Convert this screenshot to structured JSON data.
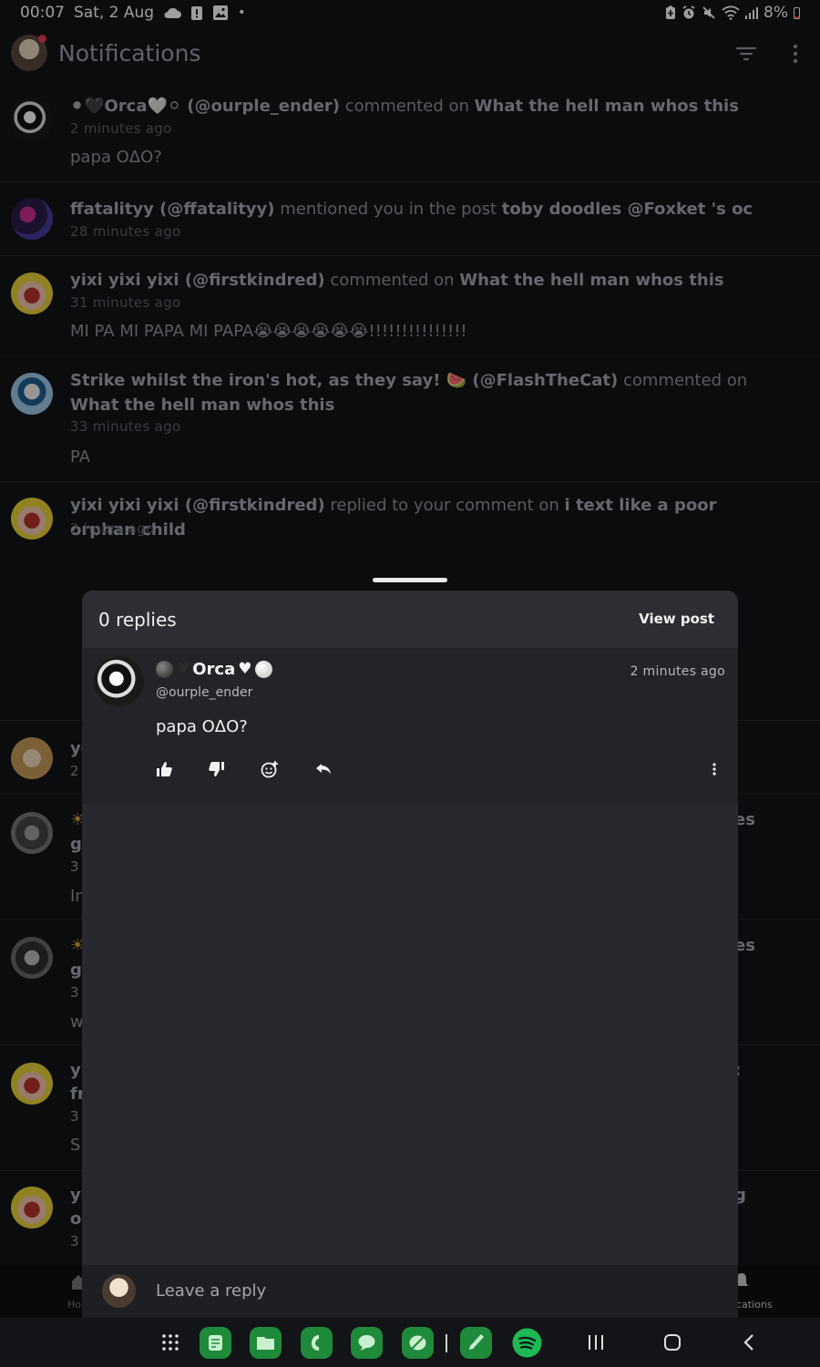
{
  "status_bar": {
    "time": "00:07",
    "date": "Sat, 2 Aug",
    "battery": "8%",
    "left_icons": [
      "cloud-icon",
      "alert-icon",
      "image-icon",
      "dot-icon"
    ],
    "right_icons": [
      "battery-saver-icon",
      "alarm-icon",
      "mute-icon",
      "wifi-icon",
      "signal-icon",
      "battery-icon"
    ]
  },
  "header": {
    "title": "Notifications"
  },
  "notifications": [
    {
      "actor": "⚫🖤Orca🤍⚪ (@ourple_ender)",
      "action": "commented on",
      "target": "What the hell man whos this",
      "time": "2 minutes ago",
      "body": "papa OΔO?"
    },
    {
      "actor": "ffatalityy (@ffatalityy)",
      "action": "mentioned you in the post",
      "target": "toby doodles @Foxket 's oc",
      "time": "28 minutes ago",
      "body": ""
    },
    {
      "actor": "yixi yixi yixi (@firstkindred)",
      "action": "commented on",
      "target": "What the hell man whos this",
      "time": "31 minutes ago",
      "body": "MI PA MI PAPA MI PAPA😭😭😭😭😭😭!!!!!!!!!!!!!!!"
    },
    {
      "actor": "Strike whilst the iron's hot, as they say! 🍉 (@FlashTheCat)",
      "action": "commented on",
      "target": "What the hell man whos this",
      "time": "33 minutes ago",
      "body": "PA"
    },
    {
      "actor": "yixi yixi yixi (@firstkindred)",
      "action": "replied to your comment on",
      "target": "i text like a poor orphan child",
      "time": "2 hours ago",
      "body": ""
    }
  ],
  "obscured_fragments": {
    "n6_a": "yo",
    "n6_b": "2",
    "n7_a": "☀",
    "n7_b": "gc",
    "n7_c": "3",
    "n7_d": "In",
    "n7_e": "es",
    "n8_a": "☀",
    "n8_b": "gc",
    "n8_c": "3",
    "n8_d": "w",
    "n8_e": "es",
    "n9_a": "yi",
    "n9_b": "fr",
    "n9_c": "3",
    "n9_d": "S",
    "n9_e": ":",
    "n10_a": "yi",
    "n10_b": "oc",
    "n10_c": "3",
    "n10_e": "g"
  },
  "bottom_nav": {
    "home_label": "Ho",
    "notifications_label": "cations"
  },
  "sheet": {
    "title": "0 replies",
    "view_post_label": "View post",
    "comment": {
      "name": "Orca",
      "handle": "@ourple_ender",
      "time": "2 minutes ago",
      "text": "papa OΔO?"
    },
    "reply_placeholder": "Leave a reply"
  },
  "dock_apps": [
    "apps-grid-icon",
    "notes-app-icon",
    "files-app-icon",
    "phone-app-icon",
    "messages-app-icon",
    "leaf-app-icon",
    "brush-app-icon",
    "spotify-app-icon"
  ],
  "colors": {
    "background": "#131417",
    "sheet": "#27292e",
    "accent_green": "#1db954"
  }
}
